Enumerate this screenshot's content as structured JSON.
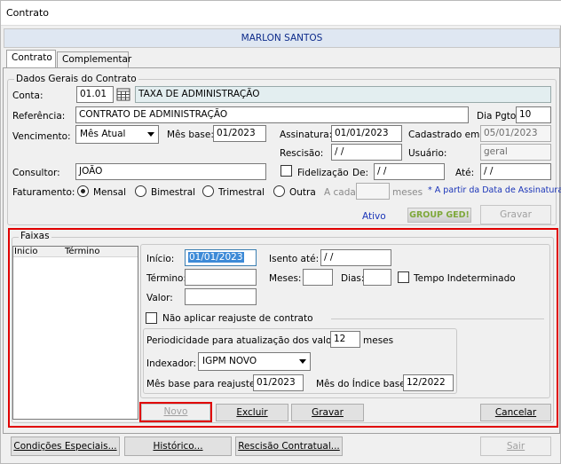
{
  "window": {
    "title": "Contrato"
  },
  "client_name": "MARLON SANTOS",
  "tabs": [
    {
      "label": "Contrato"
    },
    {
      "label": "Complementar"
    }
  ],
  "dados": {
    "group_title": "Dados Gerais do Contrato",
    "conta_label": "Conta:",
    "conta_code": "01.01",
    "conta_desc": "TAXA DE ADMINISTRAÇÃO",
    "referencia_label": "Referência:",
    "referencia": "CONTRATO DE ADMINISTRAÇÃO",
    "dia_pgto_label": "Dia Pgto:",
    "dia_pgto": "10",
    "vencimento_label": "Vencimento:",
    "vencimento": "Mês Atual",
    "mes_base_label": "Mês base:",
    "mes_base": "01/2023",
    "assinatura_label": "Assinatura:",
    "assinatura": "01/01/2023",
    "cadastrado_label": "Cadastrado em:",
    "cadastrado": "05/01/2023",
    "rescisao_label": "Rescisão:",
    "rescisao": " / /",
    "usuario_label": "Usuário:",
    "usuario": "geral",
    "consultor_label": "Consultor:",
    "consultor": "JOÃO",
    "fidelizacao_label": "Fidelização",
    "de_label": "De:",
    "de": " / /",
    "ate_label": "Até:",
    "ate": " / /",
    "faturamento_label": "Faturamento:",
    "fat_options": [
      "Mensal",
      "Bimestral",
      "Trimestral",
      "Outra"
    ],
    "a_cada_label": "A cada",
    "meses_label": "meses",
    "note": "* A partir da Data de Assinatura",
    "status": "Ativo",
    "logo_text": "GROUP GED!",
    "gravar_label": "Gravar"
  },
  "faixas": {
    "group_title": "Faixas",
    "col_inicio": "Inicio",
    "col_termino": "Término",
    "inicio_label": "Início:",
    "inicio": "01/01/2023",
    "isento_label": "Isento até:",
    "isento": " / /",
    "termino_label": "Término:",
    "meses_label": "Meses:",
    "dias_label": "Dias:",
    "tempo_label": "Tempo Indeterminado",
    "valor_label": "Valor:",
    "nao_aplicar_label": "Não aplicar reajuste de contrato",
    "periodicidade_label": "Periodicidade para atualização dos valores:",
    "periodicidade": "12",
    "periodicidade_unit": "meses",
    "indexador_label": "Indexador:",
    "indexador": "IGPM NOVO",
    "mes_base_reaj_label": "Mês base para reajuste:",
    "mes_base_reaj": "01/2023",
    "mes_indice_label": "Mês do Índice base:",
    "mes_indice": "12/2022",
    "btn_novo": "Novo",
    "btn_excluir": "Excluir",
    "btn_gravar": "Gravar",
    "btn_cancelar": "Cancelar"
  },
  "footer": {
    "condicoes": "Condições Especiais...",
    "historico": "Histórico...",
    "rescisao": "Rescisão Contratual...",
    "sair": "Sair"
  },
  "colors": {
    "highlight": "#e00000",
    "accent_text": "#1a34b8"
  }
}
